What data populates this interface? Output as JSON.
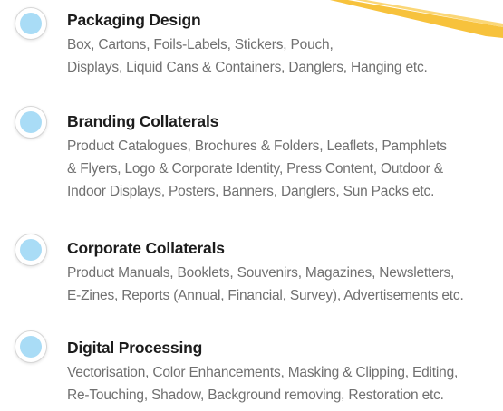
{
  "colors": {
    "bullet_fill": "#a9dcf6",
    "bullet_ring": "#d6d6d6",
    "title": "#1c1c1c",
    "text": "#707070",
    "accent_stroke": "#f7c23c"
  },
  "services": [
    {
      "title": "Packaging Design",
      "lines": [
        "Box, Cartons, Foils-Labels, Stickers, Pouch,",
        "Displays, Liquid Cans & Containers, Danglers, Hanging etc."
      ]
    },
    {
      "title": "Branding Collaterals",
      "lines": [
        "Product Catalogues, Brochures & Folders, Leaflets, Pamphlets",
        "& Flyers, Logo & Corporate Identity, Press Content, Outdoor &",
        "Indoor Displays, Posters, Banners, Danglers, Sun Packs etc."
      ]
    },
    {
      "title": "Corporate Collaterals",
      "lines": [
        "Product Manuals, Booklets, Souvenirs, Magazines, Newsletters,",
        "E-Zines, Reports (Annual, Financial, Survey), Advertisements etc."
      ]
    },
    {
      "title": "Digital Processing",
      "lines": [
        "Vectorisation, Color Enhancements, Masking & Clipping, Editing,",
        "Re-Touching, Shadow, Background removing, Restoration etc."
      ]
    }
  ]
}
